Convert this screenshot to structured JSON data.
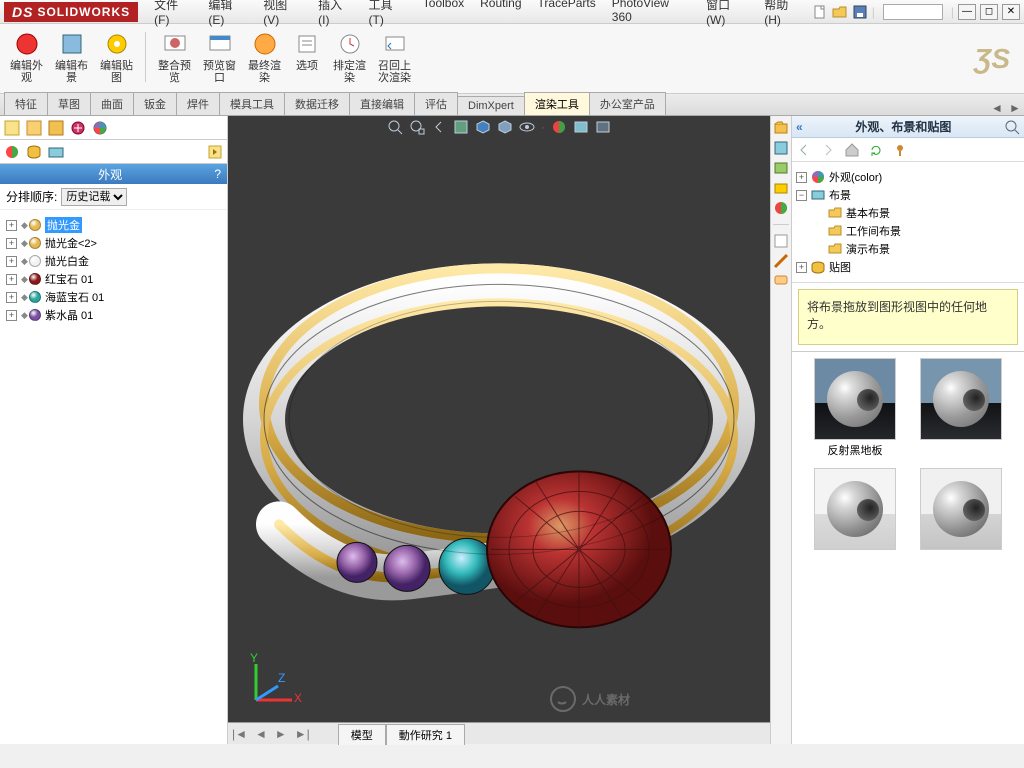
{
  "app": {
    "name": "SOLIDWORKS"
  },
  "menus": [
    "文件(F)",
    "编辑(E)",
    "视图(V)",
    "插入(I)",
    "工具(T)",
    "Toolbox",
    "Routing",
    "TraceParts",
    "PhotoView 360",
    "窗口(W)",
    "帮助(H)"
  ],
  "cmd_buttons": [
    {
      "label": "编辑外\n观"
    },
    {
      "label": "编辑布\n景"
    },
    {
      "label": "编辑贴\n图"
    },
    {
      "sep": true
    },
    {
      "label": "整合预\n览"
    },
    {
      "label": "预览窗\n口"
    },
    {
      "label": "最终渲\n染"
    },
    {
      "label": "选项"
    },
    {
      "label": "排定渲\n染"
    },
    {
      "label": "召回上\n次渲染"
    }
  ],
  "feature_tabs": [
    "特征",
    "草图",
    "曲面",
    "钣金",
    "焊件",
    "模具工具",
    "数据迁移",
    "直接编辑",
    "评估",
    "DimXpert",
    "渲染工具",
    "办公室产品"
  ],
  "feature_tab_active_index": 10,
  "left": {
    "header": "外观",
    "sort_label": "分排顺序:",
    "sort_value": "历史记载",
    "materials": [
      {
        "label": "抛光金",
        "color": "#e6b84d",
        "selected": true
      },
      {
        "label": "抛光金<2>",
        "color": "#e6b84d"
      },
      {
        "label": "抛光白金",
        "color": "#f2f2f2"
      },
      {
        "label": "红宝石 01",
        "color": "#8b1a1a"
      },
      {
        "label": "海蓝宝石 01",
        "color": "#2aa6a0"
      },
      {
        "label": "紫水晶 01",
        "color": "#7a4ea0"
      }
    ]
  },
  "bottom_tabs": [
    "模型",
    "動作研究 1"
  ],
  "right": {
    "title": "外观、布景和贴图",
    "tree": {
      "appearance": "外观(color)",
      "scene": "布景",
      "scene_children": [
        "基本布景",
        "工作间布景",
        "演示布景"
      ],
      "decal": "贴图"
    },
    "hint": "将布景拖放到图形视图中的任何地方。",
    "thumbs": [
      {
        "label": "反射黑地板",
        "bg": "linear-gradient(#6c8aa3 0%,#6c8aa3 55%,#0e1013 55%,#24262a 100%)"
      },
      {
        "label": "",
        "bg": "linear-gradient(#f4f4f4 0%,#f4f4f4 56%,#dadada 56%,#c8c8c8 100%)"
      }
    ]
  },
  "watermark": "人人素材"
}
